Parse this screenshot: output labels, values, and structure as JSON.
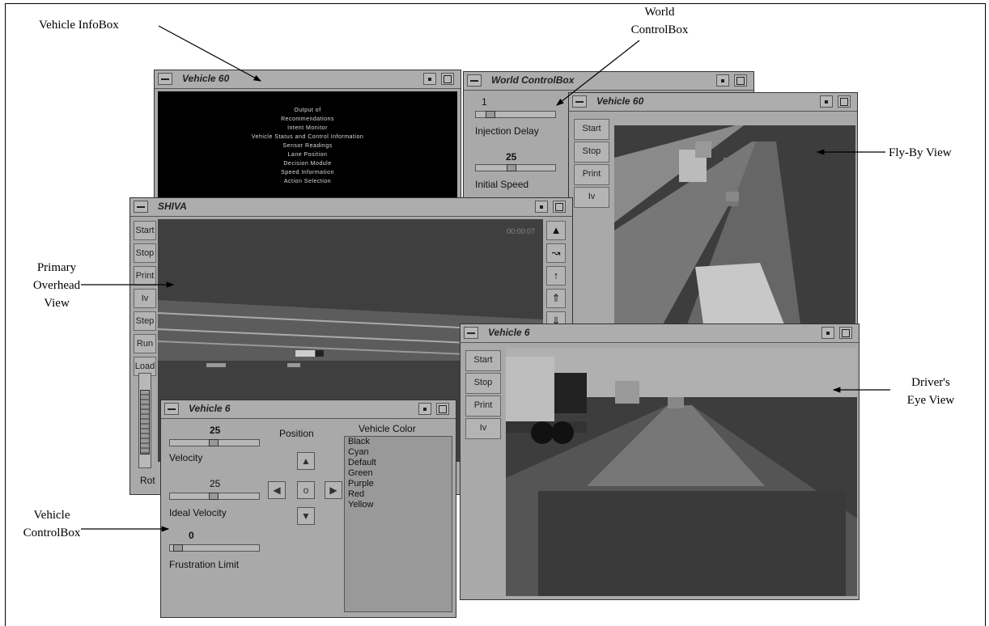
{
  "callouts": {
    "vehicle_infobox": "Vehicle InfoBox",
    "world_controlbox": [
      "World",
      "ControlBox"
    ],
    "flyby_view": "Fly-By View",
    "primary_overhead": [
      "Primary",
      "Overhead",
      "View"
    ],
    "drivers_eye": [
      "Driver's",
      "Eye View"
    ],
    "vehicle_controlbox": [
      "Vehicle",
      "ControlBox"
    ]
  },
  "info_window": {
    "title": "Vehicle 60",
    "lines": [
      "Output of",
      "Recommendations",
      "Intent Monitor",
      "Vehicle Status and Control Information",
      "Sensor Readings",
      "Lane Position",
      "Decision Module",
      "Speed Information",
      "Action Selection"
    ]
  },
  "world_window": {
    "title": "World ControlBox",
    "injection_value": "1",
    "injection_label": "Injection Delay",
    "speed_value": "25",
    "speed_label": "Initial Speed"
  },
  "flyby_window": {
    "title": "Vehicle 60",
    "buttons": [
      "Start",
      "Stop",
      "Print",
      "Iv"
    ]
  },
  "shiva_window": {
    "title": "SHIVA",
    "timer": "00:00:07",
    "buttons": [
      "Start",
      "Stop",
      "Print",
      "Iv",
      "Step",
      "Run",
      "Load"
    ],
    "rot_label": "Rot",
    "tools": [
      "pointer-tool",
      "measure-tool",
      "probe-tool",
      "zoom-in-tool",
      "zoom-out-tool"
    ]
  },
  "driver_window": {
    "title": "Vehicle 6",
    "buttons": [
      "Start",
      "Stop",
      "Print",
      "Iv"
    ]
  },
  "control_window": {
    "title": "Vehicle 6",
    "velocity_value": "25",
    "velocity_label": "Velocity",
    "ideal_value": "25",
    "ideal_label": "Ideal Velocity",
    "frust_value": "0",
    "frust_label": "Frustration Limit",
    "position_label": "Position",
    "color_label": "Vehicle Color",
    "center_button": "o",
    "colors": [
      "Black",
      "Cyan",
      "Default",
      "Green",
      "Purple",
      "Red",
      "Yellow"
    ]
  },
  "theme": {
    "window_bg": "#a9a9a9",
    "scene_dark": "#3f3f3f",
    "road": "#555555"
  }
}
